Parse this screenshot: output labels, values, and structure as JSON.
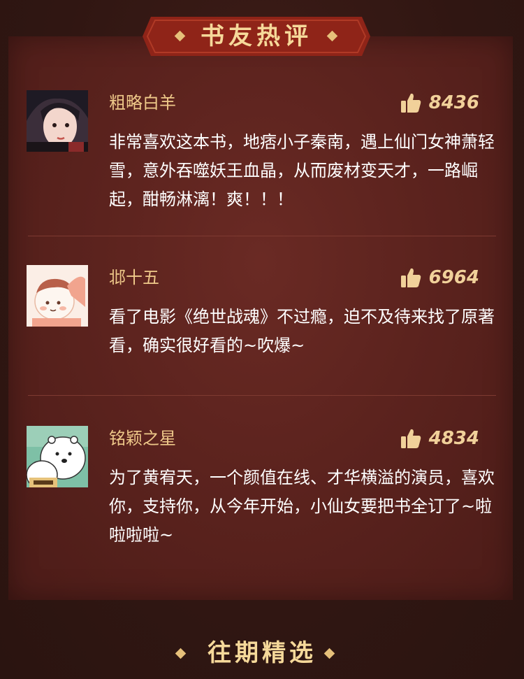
{
  "header": {
    "title": "书友热评"
  },
  "reviews": [
    {
      "username": "粗略白羊",
      "likes": "8436",
      "comment": "非常喜欢这本书，地痞小子秦南，遇上仙门女神萧轻雪，意外吞噬妖王血晶，从而废材变天才，一路崛起，酣畅淋漓！爽！！！"
    },
    {
      "username": "邶十五",
      "likes": "6964",
      "comment": "看了电影《绝世战魂》不过瘾，迫不及待来找了原著看，确实很好看的~吹爆~"
    },
    {
      "username": "铭颖之星",
      "likes": "4834",
      "comment": "为了黄宥天，一个颜值在线、才华横溢的演员，喜欢你，支持你，从今年开始，小仙女要把书全订了~啦啦啦啦~"
    }
  ],
  "footer": {
    "title": "往期精选"
  },
  "colors": {
    "accent": "#efc98a",
    "banner": "#8f2418",
    "panel": "#5c231e"
  }
}
